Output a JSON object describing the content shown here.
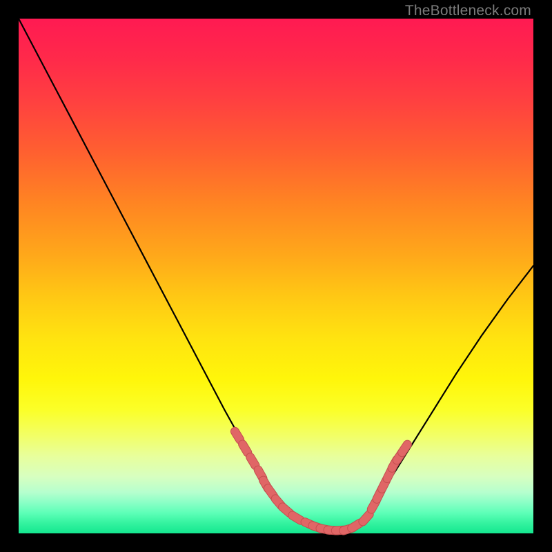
{
  "watermark": "TheBottleneck.com",
  "colors": {
    "background": "#000000",
    "curve_stroke": "#000000",
    "marker_fill": "#e06666",
    "marker_stroke": "#c44f4f"
  },
  "chart_data": {
    "type": "line",
    "title": "",
    "xlabel": "",
    "ylabel": "",
    "xlim": [
      0,
      100
    ],
    "ylim": [
      0,
      100
    ],
    "grid": false,
    "legend": false,
    "x": [
      0,
      5,
      10,
      15,
      20,
      25,
      30,
      35,
      40,
      45,
      50,
      52,
      54,
      56,
      58,
      60,
      62,
      64,
      66,
      68,
      70,
      75,
      80,
      85,
      90,
      95,
      100
    ],
    "y": [
      100,
      90.5,
      81,
      71.5,
      62,
      52.5,
      43,
      33.5,
      24,
      15,
      7,
      4.8,
      3.2,
      2.0,
      1.2,
      0.7,
      0.5,
      0.7,
      1.5,
      3.5,
      7,
      15,
      23,
      31,
      38.5,
      45.5,
      52
    ],
    "markers": {
      "comment": "highlighted segments near the valley",
      "points": [
        {
          "x": 42.5,
          "y": 19.0
        },
        {
          "x": 44.0,
          "y": 16.5
        },
        {
          "x": 45.5,
          "y": 14.0
        },
        {
          "x": 47.0,
          "y": 11.5
        },
        {
          "x": 48.0,
          "y": 9.5
        },
        {
          "x": 49.0,
          "y": 8.0
        },
        {
          "x": 50.5,
          "y": 6.0
        },
        {
          "x": 52.0,
          "y": 4.5
        },
        {
          "x": 54.0,
          "y": 3.0
        },
        {
          "x": 56.5,
          "y": 1.8
        },
        {
          "x": 58.0,
          "y": 1.2
        },
        {
          "x": 59.5,
          "y": 0.8
        },
        {
          "x": 61.0,
          "y": 0.6
        },
        {
          "x": 62.5,
          "y": 0.6
        },
        {
          "x": 64.0,
          "y": 0.8
        },
        {
          "x": 65.5,
          "y": 1.5
        },
        {
          "x": 67.5,
          "y": 3.0
        },
        {
          "x": 69.0,
          "y": 5.5
        },
        {
          "x": 70.0,
          "y": 7.5
        },
        {
          "x": 71.0,
          "y": 9.5
        },
        {
          "x": 72.0,
          "y": 11.5
        },
        {
          "x": 73.0,
          "y": 13.5
        },
        {
          "x": 74.0,
          "y": 15.0
        },
        {
          "x": 75.0,
          "y": 16.5
        }
      ]
    }
  }
}
